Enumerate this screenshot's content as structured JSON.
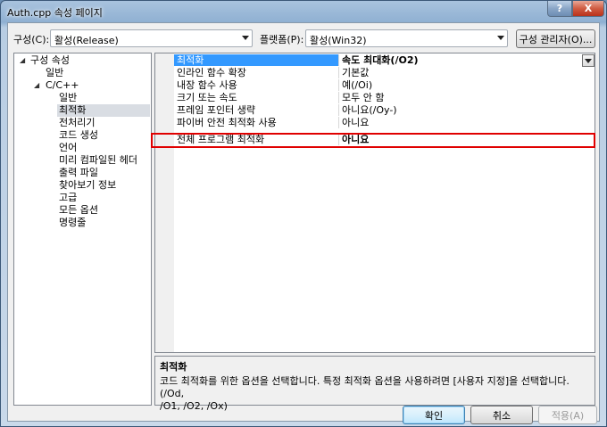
{
  "window": {
    "title": "Auth.cpp 속성 페이지",
    "help_label": "?",
    "close_label": "X"
  },
  "toolbar": {
    "config_label": "구성(C):",
    "config_value": "활성(Release)",
    "platform_label": "플랫폼(P):",
    "platform_value": "활성(Win32)",
    "config_manager_label": "구성 관리자(O)..."
  },
  "tree": {
    "root": "구성 속성",
    "general": "일반",
    "cpp": "C/C++",
    "children": [
      "일반",
      "최적화",
      "전처리기",
      "코드 생성",
      "언어",
      "미리 컴파일된 헤더",
      "출력 파일",
      "찾아보기 정보",
      "고급",
      "모든 옵션",
      "명령줄"
    ],
    "selected_index": 1
  },
  "grid": {
    "rows": [
      {
        "name": "최적화",
        "value": "속도 최대화(/O2)"
      },
      {
        "name": "인라인 함수 확장",
        "value": "기본값"
      },
      {
        "name": "내장 함수 사용",
        "value": "예(/Oi)"
      },
      {
        "name": "크기 또는 속도",
        "value": "모두 안 함"
      },
      {
        "name": "프레임 포인터 생략",
        "value": "아니요(/Oy-)"
      },
      {
        "name": "파이버 안전 최적화 사용",
        "value": "아니요"
      },
      {
        "name": "전체 프로그램 최적화",
        "value": "아니요"
      }
    ],
    "selected_row": 0,
    "highlighted_row": 6
  },
  "description": {
    "title": "최적화",
    "line1": "코드 최적화를 위한 옵션을 선택합니다. 특정 최적화 옵션을 사용하려면 [사용자 지정]을 선택합니다.    (/Od,",
    "line2": "/O1, /O2, /Ox)"
  },
  "buttons": {
    "ok": "확인",
    "cancel": "취소",
    "apply": "적용(A)"
  },
  "colors": {
    "selection": "#3399ff",
    "highlight_border": "#e00000"
  }
}
